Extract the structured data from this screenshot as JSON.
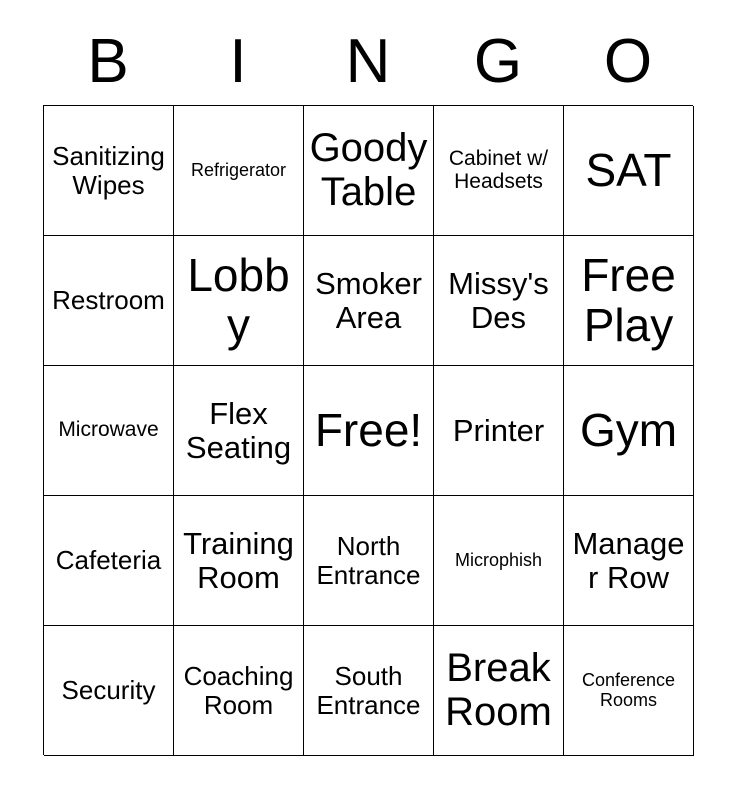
{
  "card": {
    "title": "BINGO",
    "header_letters": [
      "B",
      "I",
      "N",
      "G",
      "O"
    ],
    "grid_size": "5x5",
    "free_space_index": 12,
    "colors": {
      "background": "#ffffff",
      "border": "#000000",
      "text": "#000000"
    },
    "cells": [
      {
        "text": "Sanitizing Wipes",
        "size": "sz-m",
        "column": "B",
        "row": 1
      },
      {
        "text": "Refrigerator",
        "size": "sz-xs",
        "column": "I",
        "row": 1
      },
      {
        "text": "Goody Table",
        "size": "sz-xl",
        "column": "N",
        "row": 1
      },
      {
        "text": "Cabinet w/ Headsets",
        "size": "sz-s",
        "column": "G",
        "row": 1
      },
      {
        "text": "SAT",
        "size": "sz-xxl",
        "column": "O",
        "row": 1
      },
      {
        "text": "Restroom",
        "size": "sz-m",
        "column": "B",
        "row": 2
      },
      {
        "text": "Lobby",
        "size": "sz-xxl",
        "column": "I",
        "row": 2
      },
      {
        "text": "Smoker Area",
        "size": "sz-l",
        "column": "N",
        "row": 2
      },
      {
        "text": "Missy's Des",
        "size": "sz-l",
        "column": "G",
        "row": 2
      },
      {
        "text": "Free Play",
        "size": "sz-xxl",
        "column": "O",
        "row": 2
      },
      {
        "text": "Microwave",
        "size": "sz-s",
        "column": "B",
        "row": 3
      },
      {
        "text": "Flex Seating",
        "size": "sz-l",
        "column": "I",
        "row": 3
      },
      {
        "text": "Free!",
        "size": "sz-xxl",
        "column": "N",
        "row": 3
      },
      {
        "text": "Printer",
        "size": "sz-l",
        "column": "G",
        "row": 3
      },
      {
        "text": "Gym",
        "size": "sz-xxl",
        "column": "O",
        "row": 3
      },
      {
        "text": "Cafeteria",
        "size": "sz-m",
        "column": "B",
        "row": 4
      },
      {
        "text": "Training Room",
        "size": "sz-l",
        "column": "I",
        "row": 4
      },
      {
        "text": "North Entrance",
        "size": "sz-m",
        "column": "N",
        "row": 4
      },
      {
        "text": "Microphish",
        "size": "sz-xs",
        "column": "G",
        "row": 4
      },
      {
        "text": "Manager Row",
        "size": "sz-l",
        "column": "O",
        "row": 4
      },
      {
        "text": "Security",
        "size": "sz-m",
        "column": "B",
        "row": 5
      },
      {
        "text": "Coaching Room",
        "size": "sz-m",
        "column": "I",
        "row": 5
      },
      {
        "text": "South Entrance",
        "size": "sz-m",
        "column": "N",
        "row": 5
      },
      {
        "text": "Break Room",
        "size": "sz-xl",
        "column": "G",
        "row": 5
      },
      {
        "text": "Conference Rooms",
        "size": "sz-xs",
        "column": "O",
        "row": 5
      }
    ]
  }
}
